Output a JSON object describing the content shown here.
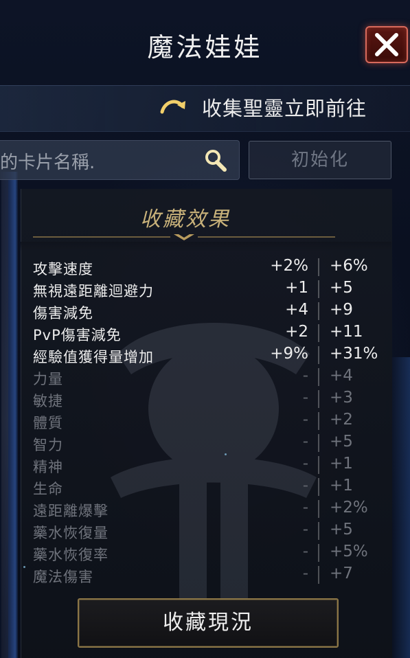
{
  "header": {
    "title": "魔法娃娃",
    "close_icon": "close-icon"
  },
  "collect_link": {
    "label": "收集聖靈立即前往",
    "icon": "curved-arrow-icon"
  },
  "search": {
    "value": "的卡片名稱.",
    "icon": "search-icon",
    "reset_label": "初始化"
  },
  "effects_panel": {
    "title": "收藏效果",
    "rows": [
      {
        "name": "攻擊速度",
        "current": "+2%",
        "max": "+6%",
        "active": true
      },
      {
        "name": "無視遠距離迴避力",
        "current": "+1",
        "max": "+5",
        "active": true
      },
      {
        "name": "傷害減免",
        "current": "+4",
        "max": "+9",
        "active": true
      },
      {
        "name": "PvP傷害減免",
        "current": "+2",
        "max": "+11",
        "active": true
      },
      {
        "name": "經驗值獲得量增加",
        "current": "+9%",
        "max": "+31%",
        "active": true
      },
      {
        "name": "力量",
        "current": "-",
        "max": "+4",
        "active": false
      },
      {
        "name": "敏捷",
        "current": "-",
        "max": "+3",
        "active": false
      },
      {
        "name": "體質",
        "current": "-",
        "max": "+2",
        "active": false
      },
      {
        "name": "智力",
        "current": "-",
        "max": "+5",
        "active": false
      },
      {
        "name": "精神",
        "current": "-",
        "max": "+1",
        "active": false
      },
      {
        "name": "生命",
        "current": "-",
        "max": "+1",
        "active": false
      },
      {
        "name": "遠距離爆擊",
        "current": "-",
        "max": "+2%",
        "active": false
      },
      {
        "name": "藥水恢復量",
        "current": "-",
        "max": "+5",
        "active": false
      },
      {
        "name": "藥水恢復率",
        "current": "-",
        "max": "+5%",
        "active": false
      },
      {
        "name": "魔法傷害",
        "current": "-",
        "max": "+7",
        "active": false
      }
    ]
  },
  "footer": {
    "status_button": "收藏現況"
  },
  "colors": {
    "gold": "#c9b27a",
    "close_red": "#d86a5c",
    "dim_text": "#6f737c"
  }
}
